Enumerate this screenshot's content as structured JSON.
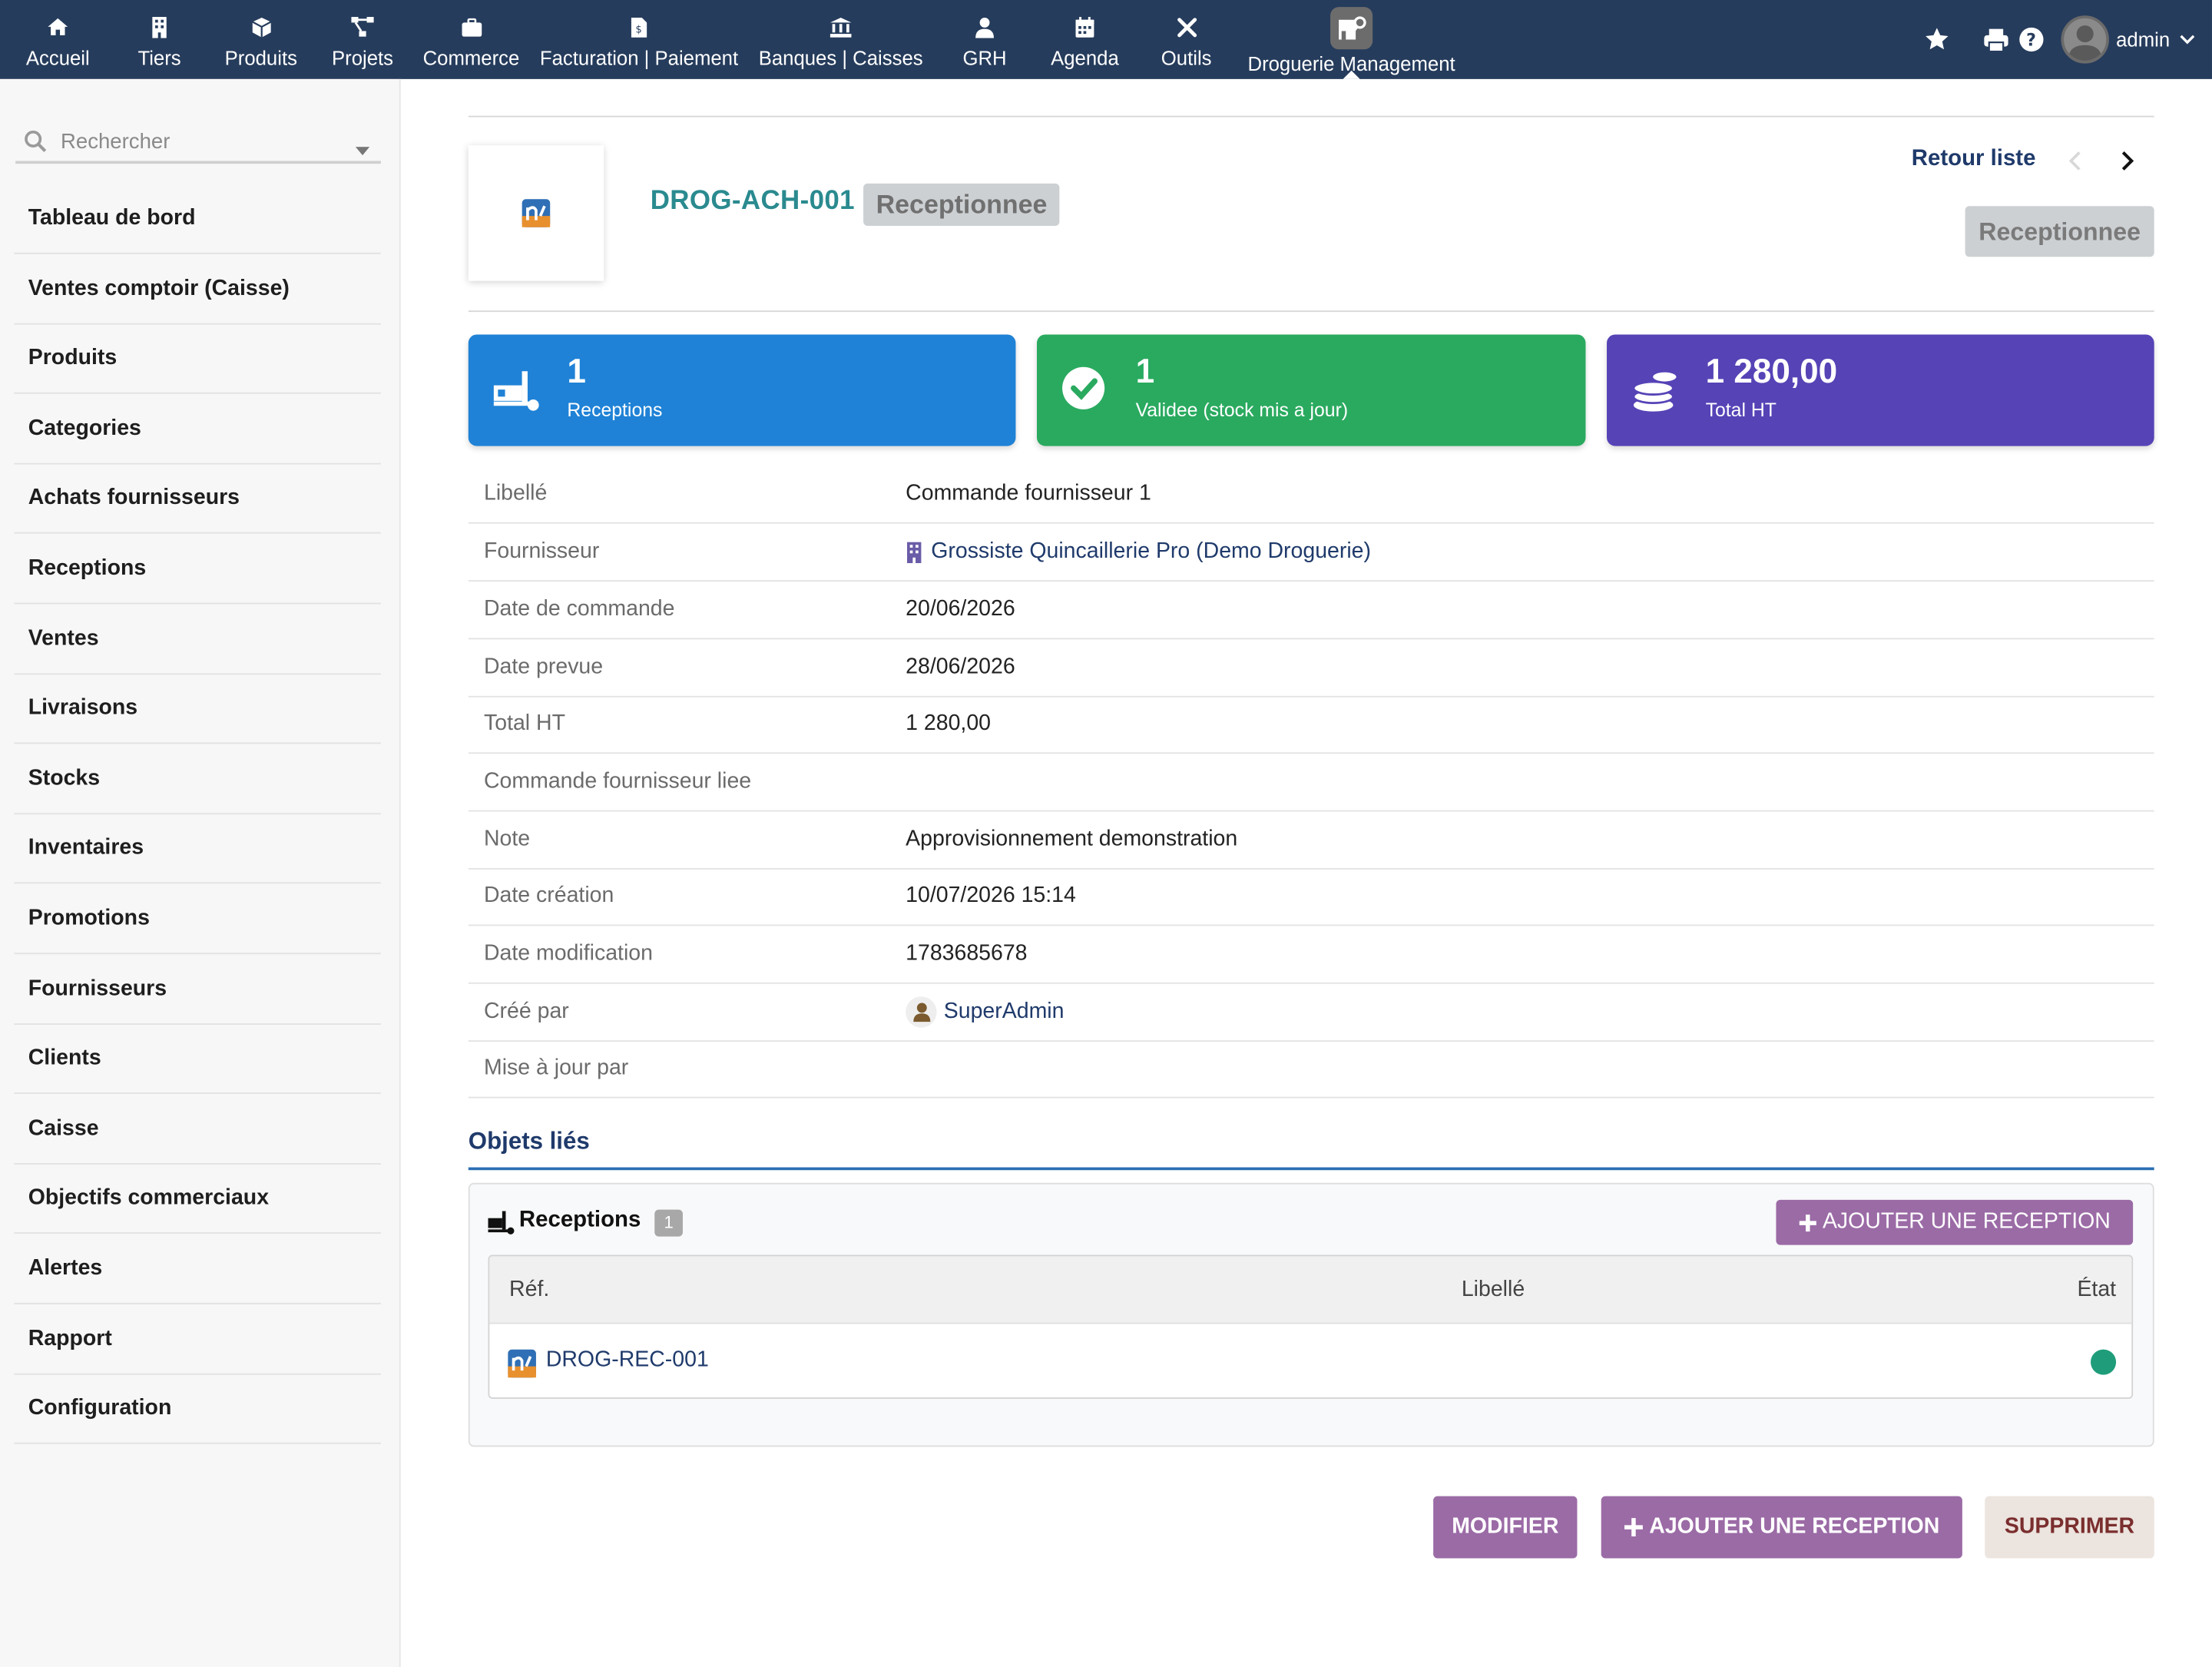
{
  "topnav": {
    "items": [
      {
        "label": "Accueil",
        "icon": "home-icon"
      },
      {
        "label": "Tiers",
        "icon": "building-icon"
      },
      {
        "label": "Produits",
        "icon": "cube-icon"
      },
      {
        "label": "Projets",
        "icon": "project-icon"
      },
      {
        "label": "Commerce",
        "icon": "briefcase-icon"
      },
      {
        "label": "Facturation | Paiement",
        "icon": "invoice-icon"
      },
      {
        "label": "Banques | Caisses",
        "icon": "bank-icon"
      },
      {
        "label": "GRH",
        "icon": "user-tie-icon"
      },
      {
        "label": "Agenda",
        "icon": "calendar-icon"
      },
      {
        "label": "Outils",
        "icon": "tools-icon"
      },
      {
        "label": "Droguerie Management",
        "icon": "droguerie-icon",
        "active": true
      }
    ],
    "user": "admin"
  },
  "sidebar": {
    "search_placeholder": "Rechercher",
    "items": [
      {
        "label": "Tableau de bord"
      },
      {
        "label": "Ventes comptoir (Caisse)"
      },
      {
        "label": "Produits"
      },
      {
        "label": "Categories"
      },
      {
        "label": "Achats fournisseurs"
      },
      {
        "label": "Receptions"
      },
      {
        "label": "Ventes"
      },
      {
        "label": "Livraisons"
      },
      {
        "label": "Stocks"
      },
      {
        "label": "Inventaires"
      },
      {
        "label": "Promotions"
      },
      {
        "label": "Fournisseurs"
      },
      {
        "label": "Clients"
      },
      {
        "label": "Caisse"
      },
      {
        "label": "Objectifs commerciaux"
      },
      {
        "label": "Alertes"
      },
      {
        "label": "Rapport"
      },
      {
        "label": "Configuration"
      }
    ]
  },
  "header": {
    "ref": "DROG-ACH-001",
    "status": "Receptionnee",
    "back_link": "Retour liste",
    "status_button": "Receptionnee"
  },
  "kpis": [
    {
      "value": "1",
      "label": "Receptions",
      "color": "#1f82d6"
    },
    {
      "value": "1",
      "label": "Validee (stock mis a jour)",
      "color": "#2aaa5f"
    },
    {
      "value": "1 280,00",
      "label": "Total HT",
      "color": "#5643b6"
    }
  ],
  "fields": [
    {
      "label": "Libellé",
      "value": "Commande fournisseur 1"
    },
    {
      "label": "Fournisseur",
      "value": "Grossiste Quincaillerie Pro (Demo Droguerie)"
    },
    {
      "label": "Date de commande",
      "value": "20/06/2026"
    },
    {
      "label": "Date prevue",
      "value": "28/06/2026"
    },
    {
      "label": "Total HT",
      "value": "1 280,00"
    },
    {
      "label": "Commande fournisseur liee",
      "value": ""
    },
    {
      "label": "Note",
      "value": "Approvisionnement demonstration"
    },
    {
      "label": "Date création",
      "value": "10/07/2026 15:14"
    },
    {
      "label": "Date modification",
      "value": "1783685678"
    },
    {
      "label": "Créé par",
      "value": "SuperAdmin"
    },
    {
      "label": "Mise à jour par",
      "value": ""
    }
  ],
  "linked": {
    "section_title": "Objets liés",
    "block_title": "Receptions",
    "count": "1",
    "add_button": "AJOUTER UNE RECEPTION",
    "columns": [
      "Réf.",
      "Libellé",
      "État"
    ],
    "rows": [
      {
        "ref": "DROG-REC-001",
        "libelle": "",
        "etat_color": "#1f9d7a"
      }
    ]
  },
  "actions": {
    "modify": "MODIFIER",
    "add_reception": "AJOUTER UNE RECEPTION",
    "delete": "SUPPRIMER"
  }
}
